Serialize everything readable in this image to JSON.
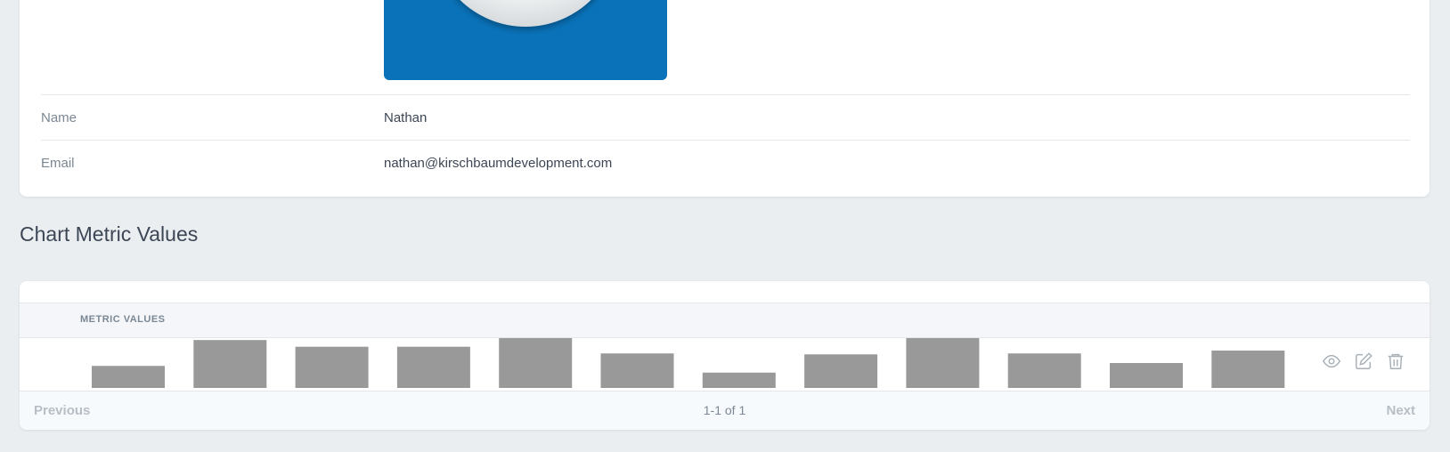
{
  "resource": {
    "fields": [
      {
        "label": "Name",
        "value": "Nathan"
      },
      {
        "label": "Email",
        "value": "nathan@kirschbaumdevelopment.com"
      }
    ]
  },
  "section": {
    "title": "Chart Metric Values"
  },
  "table": {
    "column_header": "METRIC VALUES",
    "actions": [
      "eye-icon",
      "edit-icon",
      "trash-icon"
    ],
    "pagination": {
      "previous": "Previous",
      "status": "1-1 of 1",
      "next": "Next"
    }
  },
  "chart_data": {
    "type": "bar",
    "values": [
      0.46,
      1.0,
      0.86,
      0.86,
      1.04,
      0.72,
      0.32,
      0.7,
      1.04,
      0.72,
      0.52,
      0.78
    ],
    "bar_color": "#999999"
  },
  "colors": {
    "background": "#ebeef1",
    "accent": "#0a72b8"
  }
}
